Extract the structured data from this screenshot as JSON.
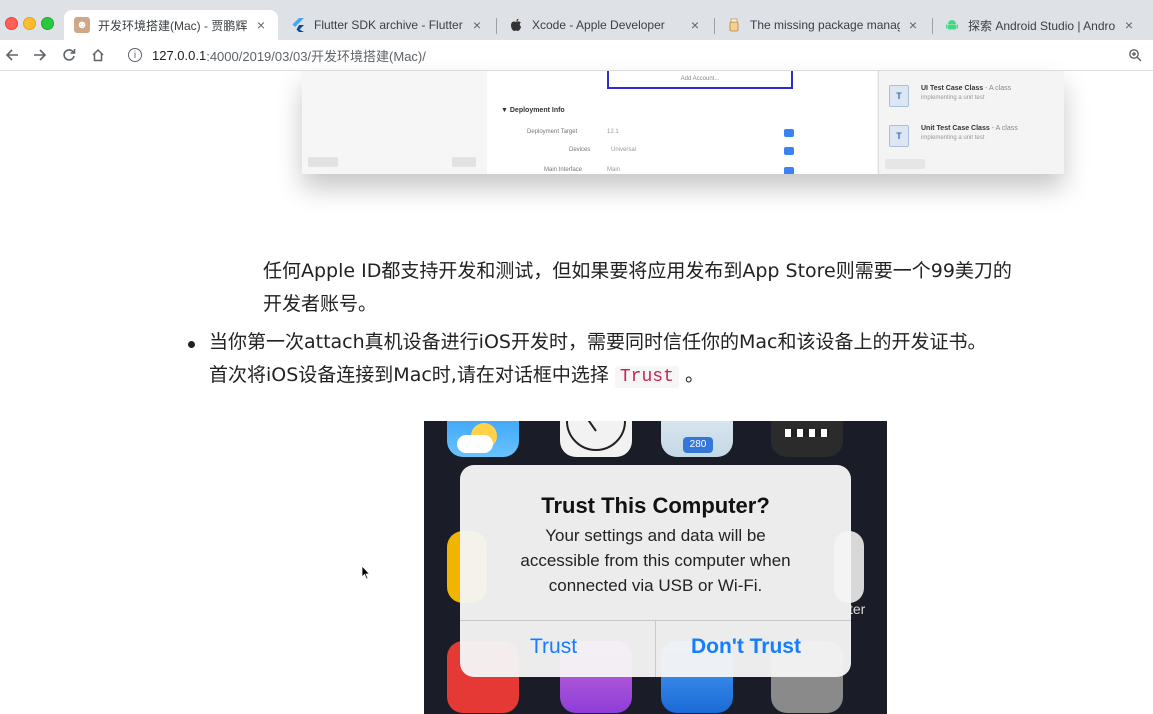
{
  "browser": {
    "tabs": [
      {
        "title": "开发环境搭建(Mac) - 贾鹏辉的",
        "active": true,
        "favicon": "blog-avatar-icon"
      },
      {
        "title": "Flutter SDK archive - Flutter",
        "active": false,
        "favicon": "flutter-icon"
      },
      {
        "title": "Xcode - Apple Developer",
        "active": false,
        "favicon": "apple-icon"
      },
      {
        "title": "The missing package manager",
        "active": false,
        "favicon": "homebrew-icon"
      },
      {
        "title": "探索 Android Studio  |  Androi",
        "active": false,
        "favicon": "android-icon"
      }
    ],
    "close_glyph": "×",
    "url_host": "127.0.0.1",
    "url_path": ":4000/2019/03/03/开发环境搭建(Mac)/"
  },
  "article": {
    "paragraph1": "任何Apple ID都支持开发和测试，但如果要将应用发布到App Store则需要一个99美刀的",
    "paragraph1_line2": "开发者账号。",
    "bullet_line1": "当你第一次attach真机设备进行iOS开发时，需要同时信任你的Mac和该设备上的开发证书。",
    "bullet_line2_pre": "首次将iOS设备连接到Mac时,请在对话框中选择",
    "bullet_code": "Trust",
    "bullet_line2_post": "。"
  },
  "xcode_screenshot": {
    "box_label": "Add Account...",
    "section": "Deployment Info",
    "rows": [
      {
        "label": "Deployment Target",
        "value": "12.1"
      },
      {
        "label": "Devices",
        "value": "Universal"
      },
      {
        "label": "Main Interface",
        "value": "Main"
      }
    ],
    "templates": [
      {
        "name": "UI Test Case Class",
        "suffix": " - A class",
        "desc": "implementing a unit test"
      },
      {
        "name": "Unit Test Case Class",
        "suffix": " - A class",
        "desc": "implementing a unit test"
      }
    ]
  },
  "ios_dialog": {
    "title": "Trust This Computer?",
    "message_lines": [
      "Your settings and data will be",
      "accessible from this computer when",
      "connected via USB or Wi-Fi."
    ],
    "trust_label": "Trust",
    "dont_trust_label": "Don't Trust",
    "calendar_badge": "280",
    "partial_label": "ter"
  },
  "colors": {
    "ios_button": "#147efb",
    "code_text": "#c7254e",
    "highlight_box": "#2c2ccf"
  }
}
